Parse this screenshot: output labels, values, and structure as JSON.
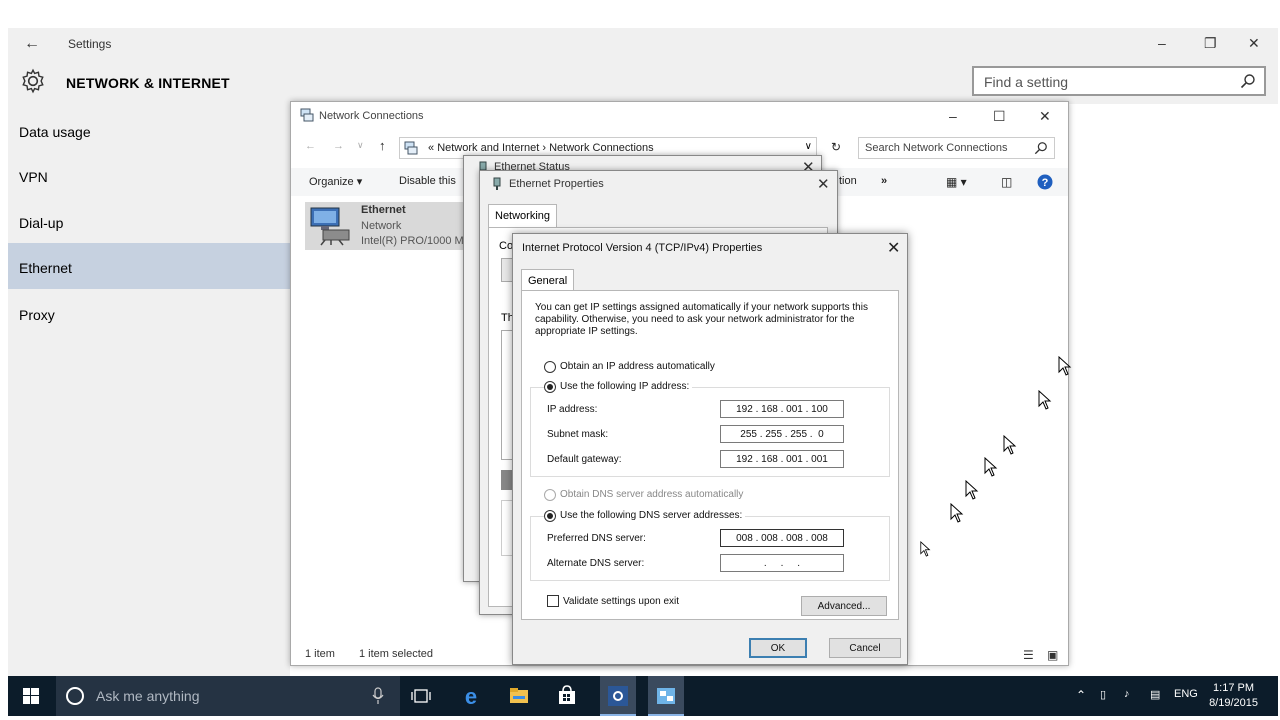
{
  "settings": {
    "title": "Settings",
    "section_title": "NETWORK & INTERNET",
    "search_placeholder": "Find a setting",
    "nav": [
      {
        "label": "Data usage"
      },
      {
        "label": "VPN"
      },
      {
        "label": "Dial-up"
      },
      {
        "label": "Ethernet",
        "selected": true
      },
      {
        "label": "Proxy"
      }
    ]
  },
  "explorer": {
    "title": "Network Connections",
    "breadcrumb": [
      "Network and Internet",
      "Network Connections"
    ],
    "search_placeholder": "Search Network Connections",
    "toolbar": {
      "organize": "Organize",
      "disable": "Disable this",
      "more_partial": "tion",
      "overflow": "»"
    },
    "item": {
      "name": "Ethernet",
      "status": "Network",
      "adapter": "Intel(R) PRO/1000 M"
    },
    "status_count": "1 item",
    "status_selected": "1 item selected"
  },
  "ethernet_status": {
    "title": "Ethernet Status"
  },
  "ethernet_properties": {
    "title": "Ethernet Properties",
    "tab": "Networking",
    "partial_label_1": "Co",
    "partial_label_2": "Th"
  },
  "ipv4": {
    "title": "Internet Protocol Version 4 (TCP/IPv4) Properties",
    "tab": "General",
    "description": "You can get IP settings assigned automatically if your network supports this capability. Otherwise, you need to ask your network administrator for the appropriate IP settings.",
    "ip_auto_label": "Obtain an IP address automatically",
    "ip_manual_label": "Use the following IP address:",
    "ip_address_label": "IP address:",
    "ip_address": "192 . 168 . 001 . 100",
    "subnet_label": "Subnet mask:",
    "subnet": "255 . 255 . 255 .  0",
    "gateway_label": "Default gateway:",
    "gateway": "192 . 168 . 001 . 001",
    "dns_auto_label": "Obtain DNS server address automatically",
    "dns_manual_label": "Use the following DNS server addresses:",
    "preferred_dns_label": "Preferred DNS server:",
    "preferred_dns": "008 . 008 . 008 . 008",
    "alternate_dns_label": "Alternate DNS server:",
    "alternate_dns": "  .     .     .  ",
    "validate_label": "Validate settings upon exit",
    "validate_checked": false,
    "advanced_label": "Advanced...",
    "ok_label": "OK",
    "cancel_label": "Cancel"
  },
  "taskbar": {
    "search_placeholder": "Ask me anything",
    "language": "ENG",
    "time": "1:17 PM",
    "date": "8/19/2015"
  },
  "icons": {
    "back": "back-arrow-icon",
    "gear": "gear-icon",
    "search": "search-icon",
    "network_connections": "network-connections-icon",
    "ethernet_adapter": "ethernet-adapter-icon",
    "help": "help-icon",
    "windows_start": "windows-start-icon",
    "edge": "edge-browser-icon",
    "file_explorer": "file-explorer-icon",
    "store": "store-icon",
    "settings_app": "settings-app-icon"
  }
}
